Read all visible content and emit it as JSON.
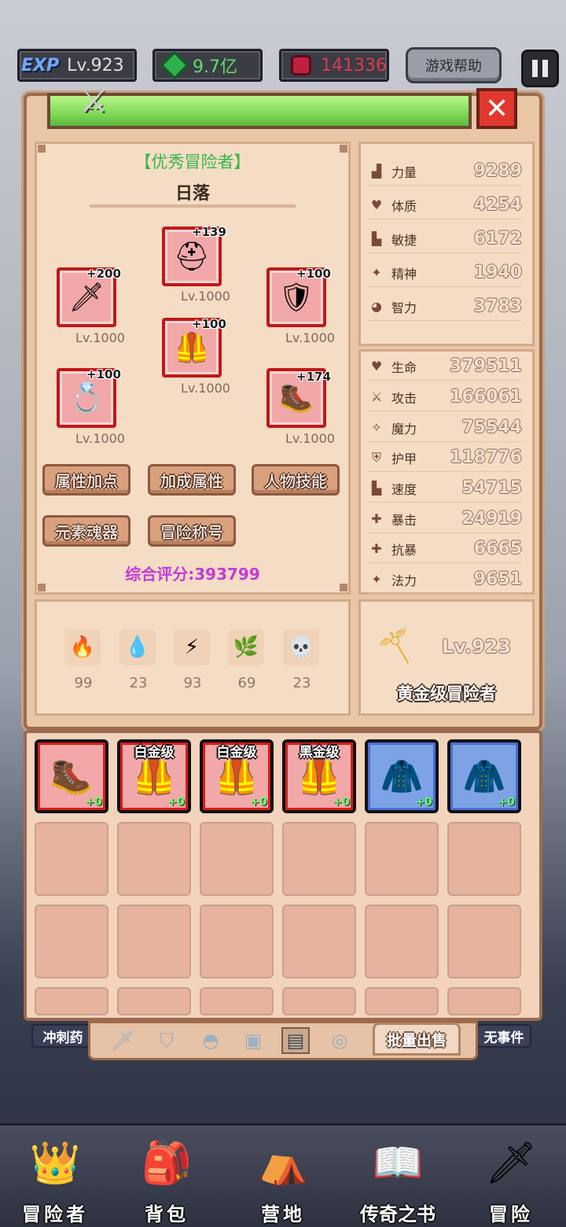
{
  "topbar": {
    "exp_tag": "EXP",
    "level": "Lv.923",
    "gems": "9.7亿",
    "rubies": "141336",
    "help_label": "游戏帮助"
  },
  "hero": {
    "rank_title": "【优秀冒险者】",
    "name": "日落",
    "equipment": [
      {
        "slot": "helmet",
        "icon": "helmet-icon",
        "glyph": "⛑",
        "plus": "+139",
        "level": "Lv.1000"
      },
      {
        "slot": "weapon",
        "icon": "sword-icon",
        "glyph": "🗡",
        "plus": "+200",
        "level": "Lv.1000"
      },
      {
        "slot": "shield",
        "icon": "shield-icon",
        "glyph": "🛡",
        "plus": "+100",
        "level": "Lv.1000"
      },
      {
        "slot": "armor",
        "icon": "armor-icon",
        "glyph": "🦺",
        "plus": "+100",
        "level": "Lv.1000"
      },
      {
        "slot": "ring",
        "icon": "ring-icon",
        "glyph": "💍",
        "plus": "+100",
        "level": "Lv.1000"
      },
      {
        "slot": "boots",
        "icon": "boots-icon",
        "glyph": "🥾",
        "plus": "+174",
        "level": "Lv.1000"
      }
    ],
    "buttons": [
      "属性加点",
      "加成属性",
      "人物技能",
      "元素魂器",
      "冒险称号"
    ],
    "score": "综合评分:393799",
    "elements": [
      {
        "icon": "fire-icon",
        "glyph": "🔥",
        "value": "99"
      },
      {
        "icon": "water-icon",
        "glyph": "💧",
        "value": "23"
      },
      {
        "icon": "lightning-icon",
        "glyph": "⚡",
        "value": "93"
      },
      {
        "icon": "nature-icon",
        "glyph": "🌿",
        "value": "69"
      },
      {
        "icon": "skull-icon",
        "glyph": "💀",
        "value": "23"
      }
    ]
  },
  "attributes": [
    {
      "label": "力量",
      "value": "9289",
      "icon": "strength-icon",
      "glyph": "▟"
    },
    {
      "label": "体质",
      "value": "4254",
      "icon": "heart-icon",
      "glyph": "♥"
    },
    {
      "label": "敏捷",
      "value": "6172",
      "icon": "boot-icon",
      "glyph": "▙"
    },
    {
      "label": "精神",
      "value": "1940",
      "icon": "star-icon",
      "glyph": "✦"
    },
    {
      "label": "智力",
      "value": "3783",
      "icon": "brain-icon",
      "glyph": "◕"
    }
  ],
  "stats": [
    {
      "label": "生命",
      "value": "379511",
      "icon": "heart-icon",
      "glyph": "♥"
    },
    {
      "label": "攻击",
      "value": "166061",
      "icon": "sword-icon",
      "glyph": "⚔"
    },
    {
      "label": "魔力",
      "value": "75544",
      "icon": "wand-icon",
      "glyph": "✧"
    },
    {
      "label": "护甲",
      "value": "118776",
      "icon": "shield-icon",
      "glyph": "⛨"
    },
    {
      "label": "速度",
      "value": "54715",
      "icon": "boot-icon",
      "glyph": "▙"
    },
    {
      "label": "暴击",
      "value": "24919",
      "icon": "crit-icon",
      "glyph": "✚"
    },
    {
      "label": "抗暴",
      "value": "6665",
      "icon": "resist-icon",
      "glyph": "✚"
    },
    {
      "label": "法力",
      "value": "9651",
      "icon": "star-icon",
      "glyph": "✦"
    }
  ],
  "rank_card": {
    "level": "Lv.923",
    "title": "黄金级冒险者"
  },
  "inventory": [
    {
      "tag": "",
      "plus": "+0",
      "frame": "red",
      "glyph": "🥾"
    },
    {
      "tag": "白金级",
      "plus": "+0",
      "frame": "red",
      "glyph": "🦺"
    },
    {
      "tag": "白金级",
      "plus": "+0",
      "frame": "red",
      "glyph": "🦺"
    },
    {
      "tag": "黑金级",
      "plus": "+0",
      "frame": "red",
      "glyph": "🦺"
    },
    {
      "tag": "",
      "plus": "+0",
      "frame": "blue",
      "glyph": "🧥"
    },
    {
      "tag": "",
      "plus": "+0",
      "frame": "blue",
      "glyph": "🧥"
    }
  ],
  "filter": {
    "bulk_sell": "批量出售",
    "tabs": [
      "sword-icon",
      "shield-icon",
      "helmet-icon",
      "armor-icon",
      "boots-icon",
      "ring-icon"
    ]
  },
  "side_tags": {
    "left": "冲刺药",
    "right": "无事件"
  },
  "nav": [
    {
      "label": "冒险者",
      "icon": "adventurer-icon",
      "glyph": "👑"
    },
    {
      "label": "背包",
      "icon": "backpack-icon",
      "glyph": "🎒"
    },
    {
      "label": "营地",
      "icon": "camp-icon",
      "glyph": "⛺"
    },
    {
      "label": "传奇之书",
      "icon": "book-icon",
      "glyph": "📖"
    },
    {
      "label": "冒险",
      "icon": "adventure-sword-icon",
      "glyph": "🗡"
    }
  ]
}
